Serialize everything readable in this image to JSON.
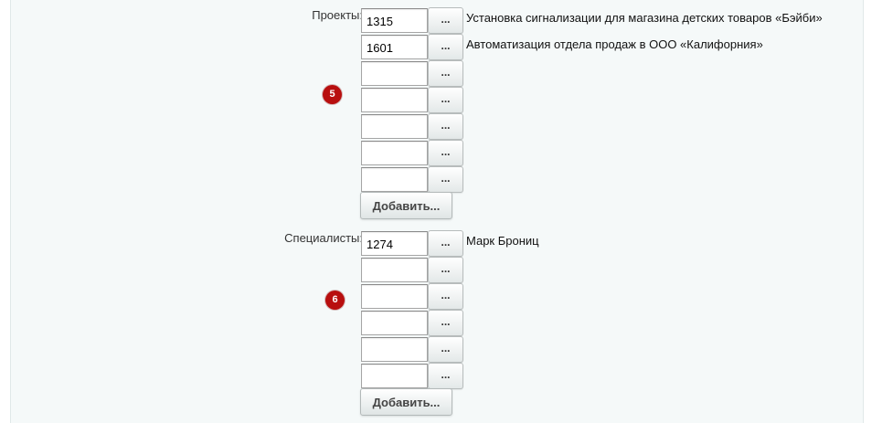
{
  "projects": {
    "label": "Проекты:",
    "badge": "5",
    "rows": [
      {
        "id": "1315",
        "name": "Установка сигнализации для магазина детских товаров «Бэйби»"
      },
      {
        "id": "1601",
        "name": "Автоматизация отдела продаж в ООО «Калифорния»"
      },
      {
        "id": "",
        "name": ""
      },
      {
        "id": "",
        "name": ""
      },
      {
        "id": "",
        "name": ""
      },
      {
        "id": "",
        "name": ""
      },
      {
        "id": "",
        "name": ""
      }
    ],
    "browse_label": "...",
    "add_label": "Добавить..."
  },
  "specialists": {
    "label": "Специалисты:",
    "badge": "6",
    "rows": [
      {
        "id": "1274",
        "name": "Марк Брониц"
      },
      {
        "id": "",
        "name": ""
      },
      {
        "id": "",
        "name": ""
      },
      {
        "id": "",
        "name": ""
      },
      {
        "id": "",
        "name": ""
      },
      {
        "id": "",
        "name": ""
      }
    ],
    "browse_label": "...",
    "add_label": "Добавить..."
  },
  "colors": {
    "badge": "#b80f0f",
    "panel_bg": "#f5f9f9"
  }
}
